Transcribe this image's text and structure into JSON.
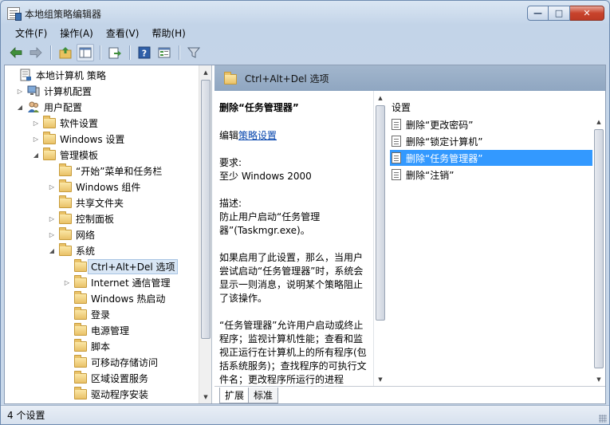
{
  "window": {
    "title": "本地组策略编辑器",
    "buttons": {
      "minimize": "—",
      "maximize": "□",
      "close": "✕"
    }
  },
  "menu": [
    "文件(F)",
    "操作(A)",
    "查看(V)",
    "帮助(H)"
  ],
  "toolbar": [
    "back-icon",
    "forward-icon",
    "up-folder-icon",
    "show-hide-tree-icon",
    "export-list-icon",
    "help-icon",
    "properties-icon",
    "filter-icon"
  ],
  "tree": {
    "items": [
      {
        "label": "本地计算机 策略",
        "icon": "policy-icon",
        "arrow": ""
      },
      {
        "label": "计算机配置",
        "icon": "computer-icon",
        "arrow": "▷"
      },
      {
        "label": "用户配置",
        "icon": "users-icon",
        "arrow": "◢"
      },
      {
        "label": "软件设置",
        "icon": "folder-icon",
        "arrow": "▷"
      },
      {
        "label": "Windows 设置",
        "icon": "folder-icon",
        "arrow": "▷"
      },
      {
        "label": "管理模板",
        "icon": "folder-icon",
        "arrow": "◢"
      },
      {
        "label": "“开始”菜单和任务栏",
        "icon": "folder-icon",
        "arrow": ""
      },
      {
        "label": "Windows 组件",
        "icon": "folder-icon",
        "arrow": "▷"
      },
      {
        "label": "共享文件夹",
        "icon": "folder-icon",
        "arrow": ""
      },
      {
        "label": "控制面板",
        "icon": "folder-icon",
        "arrow": "▷"
      },
      {
        "label": "网络",
        "icon": "folder-icon",
        "arrow": "▷"
      },
      {
        "label": "系统",
        "icon": "folder-icon",
        "arrow": "◢"
      },
      {
        "label": "Ctrl+Alt+Del 选项",
        "icon": "folder-open-icon",
        "arrow": "",
        "selected": true
      },
      {
        "label": "Internet 通信管理",
        "icon": "folder-icon",
        "arrow": "▷"
      },
      {
        "label": "Windows 热启动",
        "icon": "folder-icon",
        "arrow": ""
      },
      {
        "label": "登录",
        "icon": "folder-icon",
        "arrow": ""
      },
      {
        "label": "电源管理",
        "icon": "folder-icon",
        "arrow": ""
      },
      {
        "label": "脚本",
        "icon": "folder-icon",
        "arrow": ""
      },
      {
        "label": "可移动存储访问",
        "icon": "folder-icon",
        "arrow": ""
      },
      {
        "label": "区域设置服务",
        "icon": "folder-icon",
        "arrow": ""
      },
      {
        "label": "驱动程序安装",
        "icon": "folder-icon",
        "arrow": ""
      }
    ]
  },
  "right_pane": {
    "header": "Ctrl+Alt+Del 选项",
    "description": {
      "title": "删除“任务管理器”",
      "edit_prefix": "编辑",
      "edit_link": "策略设置",
      "req_label": "要求:",
      "req_value": "至少 Windows 2000",
      "desc_label": "描述:",
      "desc_value": "防止用户启动“任务管理器”(Taskmgr.exe)。",
      "para2": "如果启用了此设置，那么，当用户尝试启动“任务管理器”时，系统会显示一则消息，说明某个策略阻止了该操作。",
      "para3": "“任务管理器”允许用户启动或终止程序；监视计算机性能；查看和监视正运行在计算机上的所有程序(包括系统服务)；查找程序的可执行文件名；更改程序所运行的进程"
    },
    "settings_header": "设置",
    "settings": [
      {
        "label": "删除“更改密码”",
        "selected": false
      },
      {
        "label": "删除“锁定计算机”",
        "selected": false
      },
      {
        "label": "删除“任务管理器”",
        "selected": true
      },
      {
        "label": "删除“注销”",
        "selected": false
      }
    ],
    "tabs": [
      "扩展",
      "标准"
    ]
  },
  "status": "4 个设置",
  "colors": {
    "selection": "#3399ff",
    "header_band": "#9cb1ca",
    "link": "#0645ad"
  }
}
